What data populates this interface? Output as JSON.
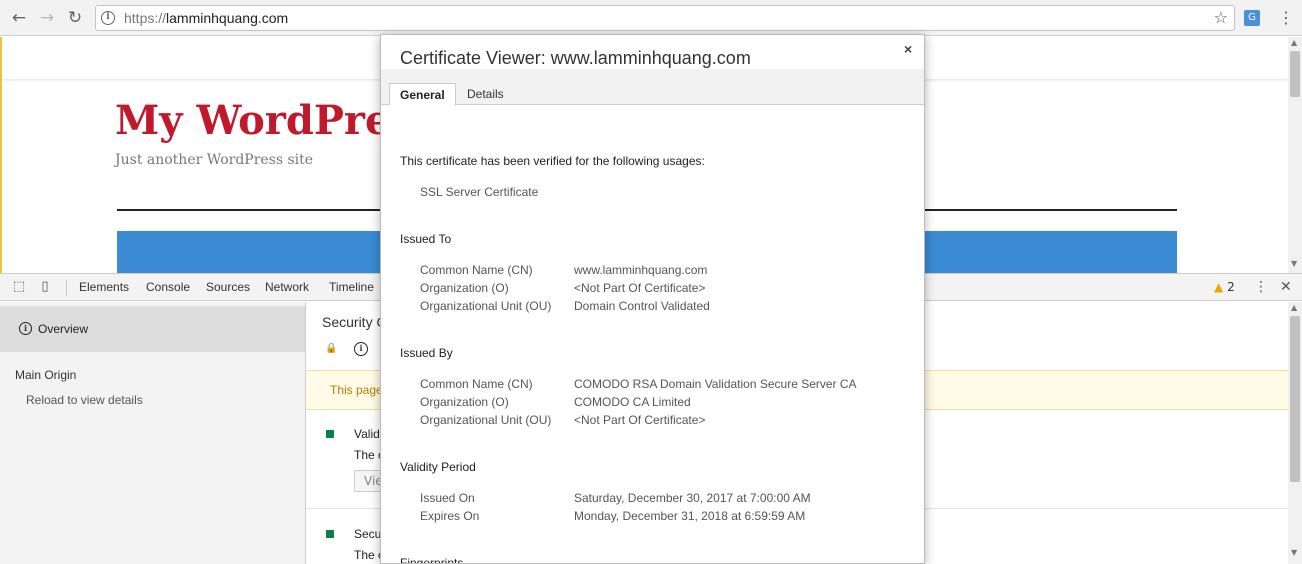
{
  "browser": {
    "url_scheme": "https://",
    "url_host": "lamminhquang.com",
    "back_icon": "←",
    "forward_icon": "→",
    "reload_icon": "↻",
    "star_icon": "☆",
    "menu_icon": "⋮"
  },
  "site": {
    "title": "My WordPress",
    "description": "Just another WordPress site",
    "title_color": "#c0192c",
    "banner_color": "#3a8bd4"
  },
  "devtools": {
    "tabs": [
      "Elements",
      "Console",
      "Sources",
      "Network",
      "Timeline"
    ],
    "warning_count": "2",
    "sidebar": {
      "overview_label": "Overview",
      "main_origin_label": "Main Origin",
      "reload_label": "Reload to view details"
    },
    "security": {
      "heading": "Security O",
      "banner_text": "This page",
      "row1_title": "Validi",
      "row1_sub": "The c",
      "view_btn": "Vie",
      "row2_title": "Secu",
      "row2_sub": "The c"
    }
  },
  "certificate": {
    "title": "Certificate Viewer: www.lamminhquang.com",
    "close_icon": "×",
    "tabs": {
      "general": "General",
      "details": "Details"
    },
    "verified_text": "This certificate has been verified for the following usages:",
    "usage": "SSL Server Certificate",
    "issued_to": {
      "heading": "Issued To",
      "cn_label": "Common Name (CN)",
      "cn_value": "www.lamminhquang.com",
      "o_label": "Organization (O)",
      "o_value": "<Not Part Of Certificate>",
      "ou_label": "Organizational Unit (OU)",
      "ou_value": "Domain Control Validated"
    },
    "issued_by": {
      "heading": "Issued By",
      "cn_label": "Common Name (CN)",
      "cn_value": "COMODO RSA Domain Validation Secure Server CA",
      "o_label": "Organization (O)",
      "o_value": "COMODO CA Limited",
      "ou_label": "Organizational Unit (OU)",
      "ou_value": "<Not Part Of Certificate>"
    },
    "validity": {
      "heading": "Validity Period",
      "issued_label": "Issued On",
      "issued_value": "Saturday, December 30, 2017 at 7:00:00 AM",
      "expires_label": "Expires On",
      "expires_value": "Monday, December 31, 2018 at 6:59:59 AM"
    },
    "fingerprints_heading": "Fingerprints"
  }
}
